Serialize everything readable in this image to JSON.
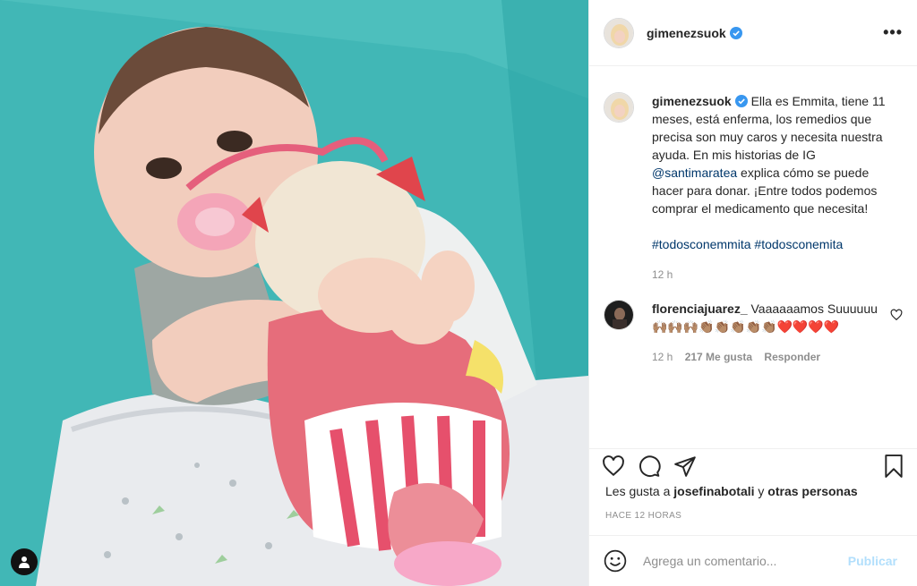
{
  "post": {
    "username": "gimenezsuok",
    "verified": true,
    "caption": "Ella es Emmita, tiene 11 meses, está enferma, los remedios que precisa son muy caros y necesita nuestra ayuda. En mis historias de IG",
    "mention": "@santimaratea",
    "caption_after": "explica cómo se puede hacer para donar. ¡Entre todos podemos comprar el medicamento que necesita!",
    "hashtags": [
      "#todosconemmita",
      "#todosconemita"
    ],
    "time": "12 h"
  },
  "comment": {
    "username": "florenciajuarez_",
    "text": "Vaaaaaamos Suuuuuu",
    "emojis": "🙌🏽🙌🏽🙌🏽👏🏽👏🏽👏🏽👏🏽👏🏽❤️❤️❤️❤️",
    "time": "12 h",
    "likes": "217 Me gusta",
    "reply": "Responder"
  },
  "likes": {
    "prefix": "Les gusta a",
    "user": "josefinabotali",
    "connector": "y",
    "others": "otras personas"
  },
  "posted_ago": "HACE 12 HORAS",
  "add_comment": {
    "placeholder": "Agrega un comentario...",
    "publish": "Publicar"
  },
  "colors": {
    "link": "#00376b",
    "publish_disabled": "#b2dffc",
    "verified": "#3897f0",
    "photo_bg": "#3fb5b5"
  },
  "icons": [
    "more-icon",
    "heart-icon",
    "comment-icon",
    "share-icon",
    "bookmark-icon",
    "emoji-icon",
    "user-tag-icon",
    "verified-badge-icon"
  ]
}
